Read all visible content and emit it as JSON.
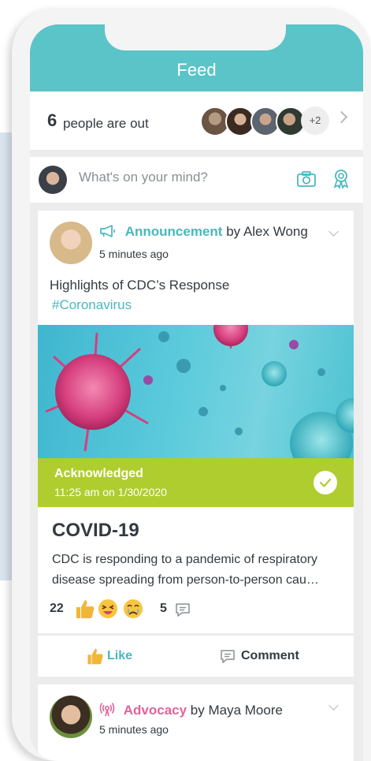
{
  "header": {
    "title": "Feed"
  },
  "out_summary": {
    "count": "6",
    "text": "people are out",
    "more": "+2"
  },
  "compose": {
    "placeholder": "What's on your mind?"
  },
  "post": {
    "kind": "Announcement",
    "by": "by Alex Wong",
    "time": "5 minutes ago",
    "text": "Highlights of CDC’s Response",
    "hashtag": "#Coronavirus",
    "ack_title": "Acknowledged",
    "ack_time": "11:25 am on 1/30/2020",
    "title": "COVID-19",
    "description": "CDC is responding to a pandemic of respiratory disease spreading from person-to-person cau…",
    "reaction_count": "22",
    "comment_count": "5"
  },
  "actions": {
    "like": "Like",
    "comment": "Comment"
  },
  "post2": {
    "kind": "Advocacy",
    "by": "by Maya Moore",
    "time": "5 minutes ago"
  },
  "colors": {
    "accent": "#5bc4c8",
    "acknowledged": "#afcd2e",
    "advocacy": "#e2629a"
  }
}
